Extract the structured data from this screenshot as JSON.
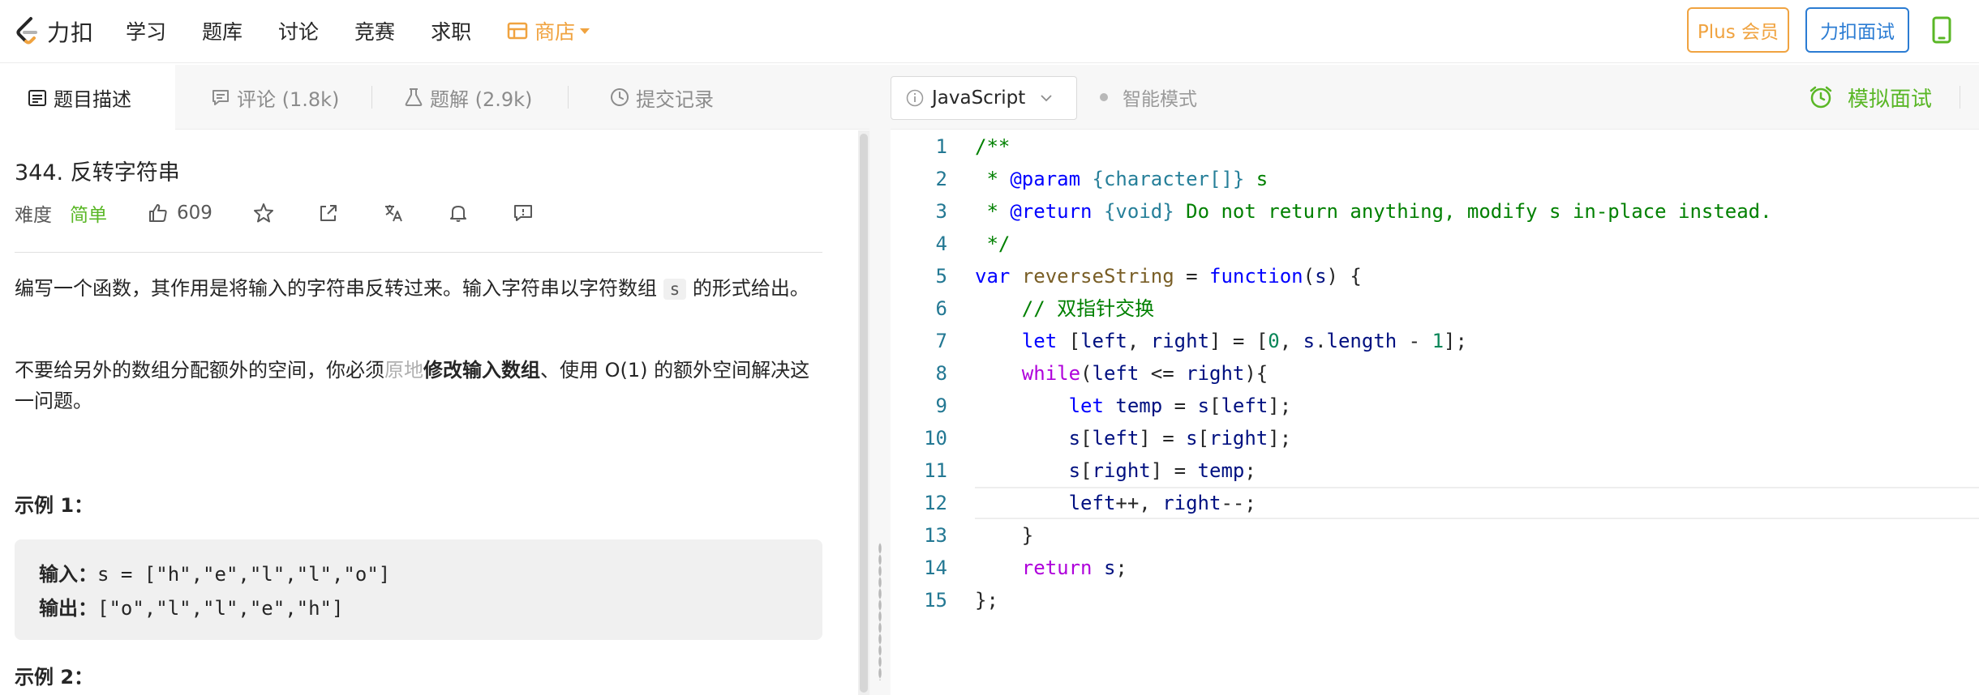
{
  "nav": {
    "logo_text": "力扣",
    "items": [
      "学习",
      "题库",
      "讨论",
      "竞赛",
      "求职"
    ],
    "store_label": "商店",
    "plus_label": "Plus 会员",
    "interview_label": "力扣面试",
    "brand_color": "#f0a340",
    "blue_color": "#2b7cd3"
  },
  "tabs": [
    {
      "label": "题目描述",
      "icon": "description-icon",
      "active": true
    },
    {
      "label": "评论 (1.8k)",
      "icon": "comment-icon"
    },
    {
      "label": "题解 (2.9k)",
      "icon": "flask-icon"
    },
    {
      "label": "提交记录",
      "icon": "clock-icon"
    }
  ],
  "problem": {
    "title": "344. 反转字符串",
    "difficulty_label": "难度",
    "difficulty": "简单",
    "difficulty_color": "#5ab726",
    "likes": "609",
    "desc1_before": "编写一个函数，其作用是将输入的字符串反转过来。输入字符串以字符数组 ",
    "desc1_code": "s",
    "desc1_after": " 的形式给出。",
    "desc2_a": "不要给另外的数组分配额外的空间，你必须",
    "desc2_b": "原地",
    "desc2_c": "修改输入数组",
    "desc2_d": "、使用 O(1) 的额外空间解决这一问题。",
    "example1_title": "示例 1：",
    "example1_input_label": "输入：",
    "example1_input": "s = [\"h\",\"e\",\"l\",\"l\",\"o\"]",
    "example1_output_label": "输出：",
    "example1_output": "[\"o\",\"l\",\"l\",\"e\",\"h\"]",
    "example2_title": "示例 2："
  },
  "editor": {
    "language": "JavaScript",
    "smart_mode": "智能模式",
    "mock_interview": "模拟面试",
    "current_line": 12,
    "lines": [
      "/**",
      " * @param {character[]} s",
      " * @return {void} Do not return anything, modify s in-place instead.",
      " */",
      "var reverseString = function(s) {",
      "    // 双指针交换",
      "    let [left, right] = [0, s.length - 1];",
      "    while(left <= right){",
      "        let temp = s[left];",
      "        s[left] = s[right];",
      "        s[right] = temp;",
      "        left++, right--;",
      "    }",
      "    return s;",
      "};"
    ],
    "line_numbers": [
      "1",
      "2",
      "3",
      "4",
      "5",
      "6",
      "7",
      "8",
      "9",
      "10",
      "11",
      "12",
      "13",
      "14",
      "15"
    ]
  }
}
